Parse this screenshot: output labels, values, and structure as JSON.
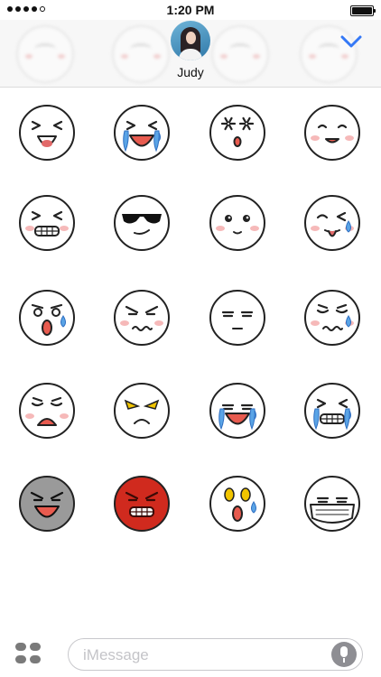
{
  "status_bar": {
    "time": "1:20 PM",
    "signal_bars": 5,
    "signal_filled": 4,
    "battery_level": 1.0
  },
  "header": {
    "contact_name": "Judy",
    "collapse_icon": "chevron-down-icon",
    "accent_color": "#3478f6"
  },
  "stickers": [
    {
      "id": "laughing-hard",
      "bg": "#ffffff",
      "eyes": "squeeze",
      "mouth": "open-tongue",
      "cheeks": false,
      "tears": false,
      "color": "#d9412e"
    },
    {
      "id": "crying-laughing",
      "bg": "#ffffff",
      "eyes": "squeeze",
      "mouth": "open-big",
      "cheeks": false,
      "tears": true,
      "color": "#2f6fc2"
    },
    {
      "id": "shocked-scream",
      "bg": "#ffffff",
      "eyes": "starburst",
      "mouth": "small-o",
      "cheeks": false,
      "tears": false,
      "color": "#d9412e"
    },
    {
      "id": "happy-smile",
      "bg": "#ffffff",
      "eyes": "arc",
      "mouth": "smile",
      "cheeks": true,
      "tears": false,
      "color": "#d9412e"
    },
    {
      "id": "grinning-wink",
      "bg": "#ffffff",
      "eyes": "squeeze",
      "mouth": "teeth",
      "cheeks": true,
      "tears": false,
      "color": "#d9412e"
    },
    {
      "id": "sunglasses-cool",
      "bg": "#ffffff",
      "eyes": "sunglasses",
      "mouth": "smirk",
      "cheeks": false,
      "tears": false,
      "color": "#111111"
    },
    {
      "id": "teary-sad",
      "bg": "#ffffff",
      "eyes": "teary",
      "mouth": "small",
      "cheeks": true,
      "tears": false,
      "color": "#333333"
    },
    {
      "id": "tongue-wink",
      "bg": "#ffffff",
      "eyes": "wink",
      "mouth": "tongue",
      "cheeks": true,
      "tears": true,
      "color": "#2f6fc2"
    },
    {
      "id": "surprised-sweat",
      "bg": "#ffffff",
      "eyes": "wide",
      "mouth": "open-o",
      "cheeks": false,
      "tears": true,
      "color": "#d9412e"
    },
    {
      "id": "annoyed",
      "bg": "#ffffff",
      "eyes": "angry",
      "mouth": "wavy",
      "cheeks": true,
      "tears": false,
      "color": "#333333"
    },
    {
      "id": "unamused",
      "bg": "#ffffff",
      "eyes": "flat",
      "mouth": "flat",
      "cheeks": false,
      "tears": false,
      "color": "#333333"
    },
    {
      "id": "nervous-sweat",
      "bg": "#ffffff",
      "eyes": "worried",
      "mouth": "wavy",
      "cheeks": true,
      "tears": true,
      "color": "#2f6fc2"
    },
    {
      "id": "upset-frown",
      "bg": "#ffffff",
      "eyes": "worried",
      "mouth": "open-frown",
      "cheeks": true,
      "tears": false,
      "color": "#d9412e"
    },
    {
      "id": "angry-glare",
      "bg": "#ffffff",
      "eyes": "yellow-angry",
      "mouth": "frown",
      "cheeks": false,
      "tears": false,
      "color": "#f2c500"
    },
    {
      "id": "sobbing-tears",
      "bg": "#ffffff",
      "eyes": "flat",
      "mouth": "open-big",
      "cheeks": false,
      "tears": true,
      "color": "#2f6fc2"
    },
    {
      "id": "crying-grit",
      "bg": "#ffffff",
      "eyes": "squeeze",
      "mouth": "teeth",
      "cheeks": false,
      "tears": true,
      "color": "#2f6fc2"
    },
    {
      "id": "dark-shadow",
      "bg": "#9a9a9a",
      "eyes": "angry",
      "mouth": "open-big",
      "cheeks": false,
      "tears": false,
      "color": "#111111"
    },
    {
      "id": "red-rage",
      "bg": "#d02a1e",
      "eyes": "angry",
      "mouth": "teeth",
      "cheeks": false,
      "tears": false,
      "color": "#f2c500"
    },
    {
      "id": "terrified",
      "bg": "#ffffff",
      "eyes": "yellow-wide",
      "mouth": "open-o",
      "cheeks": false,
      "tears": true,
      "color": "#f2c500"
    },
    {
      "id": "face-mask",
      "bg": "#ffffff",
      "eyes": "flat",
      "mouth": "mask",
      "cheeks": false,
      "tears": false,
      "color": "#333333"
    }
  ],
  "composer": {
    "placeholder": "iMessage",
    "value": "",
    "apps_icon": "app-drawer-icon",
    "mic_icon": "microphone-icon"
  }
}
